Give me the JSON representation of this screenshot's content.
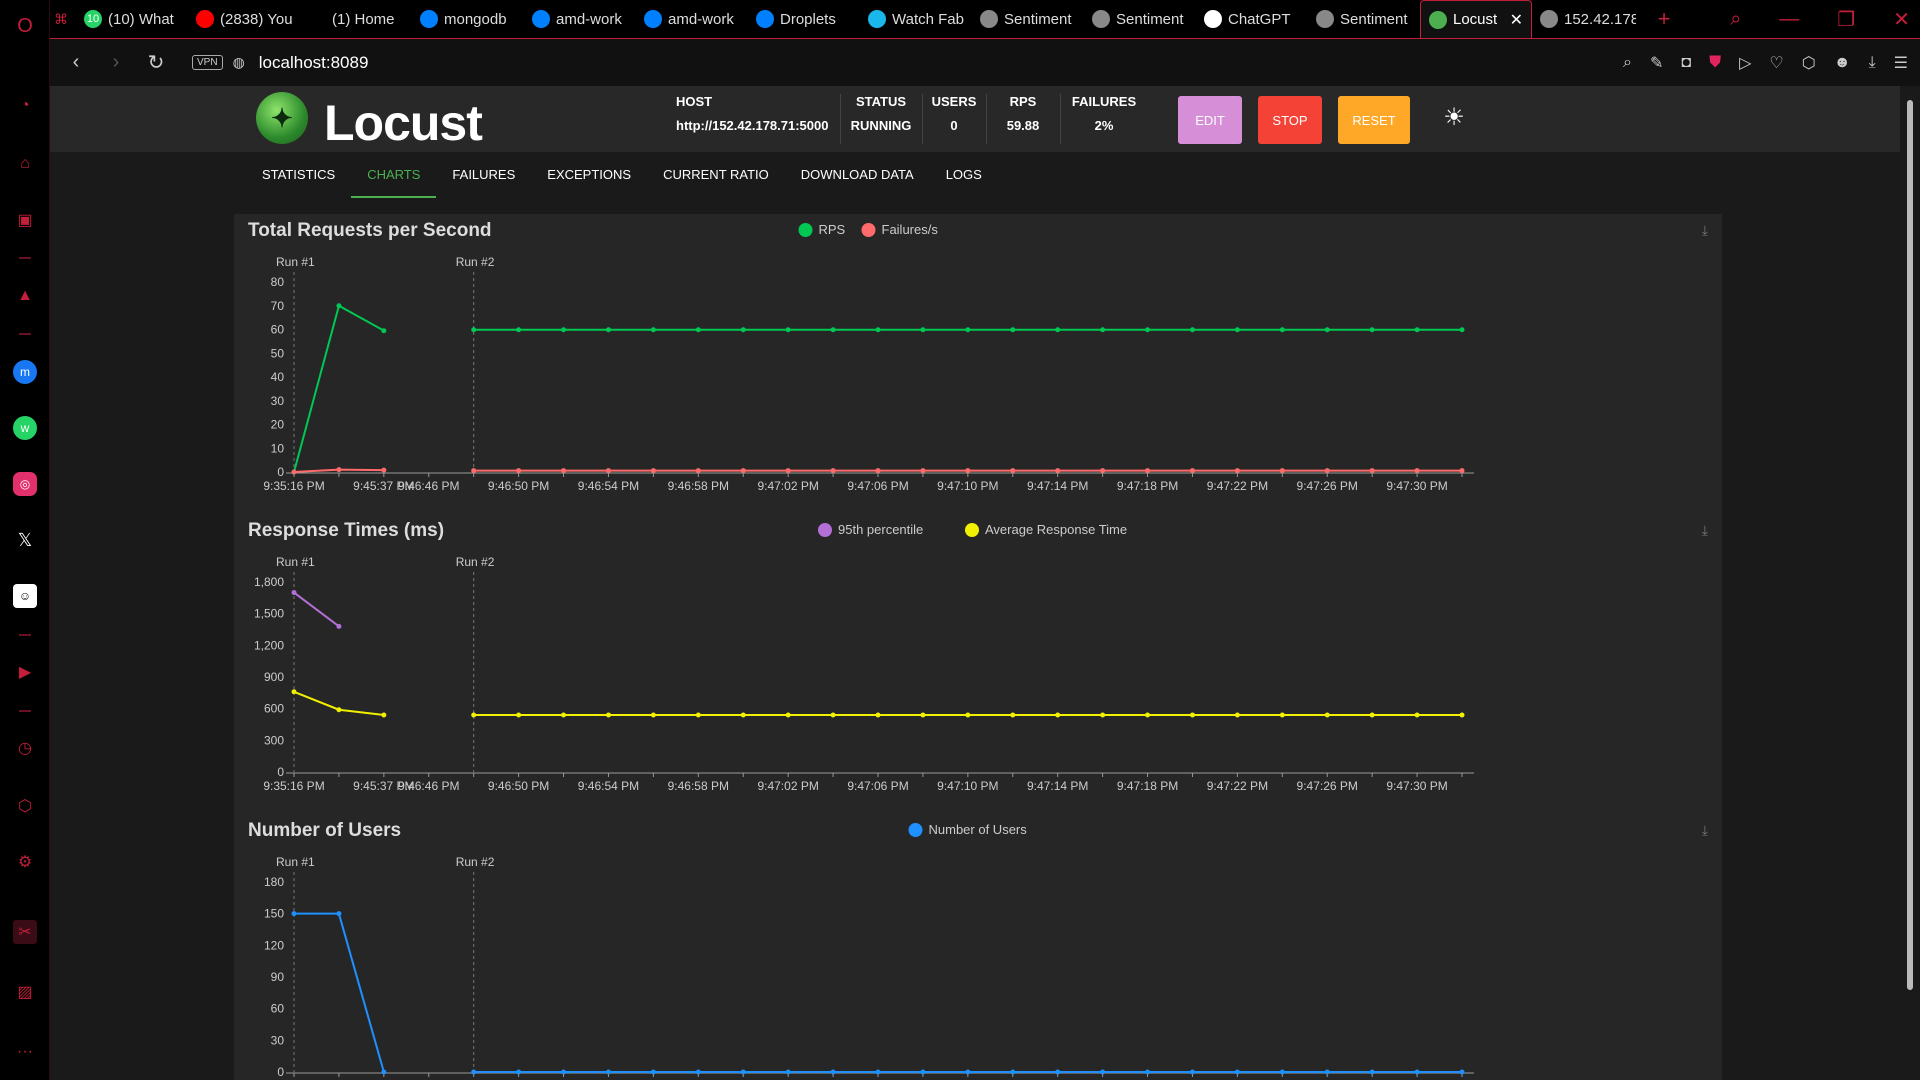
{
  "browser": {
    "tabs": [
      {
        "title": "(10) What",
        "icon": "whatsapp-icon",
        "color": "#25d366",
        "badge": "10"
      },
      {
        "title": "(2838) You",
        "icon": "youtube-icon",
        "color": "#ff0000"
      },
      {
        "title": "(1) Home",
        "icon": "x-icon",
        "color": "#000000"
      },
      {
        "title": "mongodb",
        "icon": "digitalocean-icon",
        "color": "#0080ff"
      },
      {
        "title": "amd-work",
        "icon": "digitalocean-icon",
        "color": "#0080ff"
      },
      {
        "title": "amd-work",
        "icon": "digitalocean-icon",
        "color": "#0080ff"
      },
      {
        "title": "Droplets",
        "icon": "digitalocean-icon",
        "color": "#0080ff"
      },
      {
        "title": "Watch Fab",
        "icon": "play-icon",
        "color": "#1ab7ea"
      },
      {
        "title": "Sentiment",
        "icon": "globe-icon",
        "color": "#888888"
      },
      {
        "title": "Sentiment",
        "icon": "globe-icon",
        "color": "#888888"
      },
      {
        "title": "ChatGPT",
        "icon": "chatgpt-icon",
        "color": "#ffffff"
      },
      {
        "title": "Sentiment",
        "icon": "globe-icon",
        "color": "#888888"
      },
      {
        "title": "Locust",
        "icon": "locust-icon",
        "color": "#4caf50",
        "active": true
      },
      {
        "title": "152.42.178",
        "icon": "globe-icon",
        "color": "#888888"
      }
    ],
    "url": "localhost:8089",
    "vpn_label": "VPN"
  },
  "locust": {
    "logo_text": "Locust",
    "host_label": "HOST",
    "host_value": "http://152.42.178.71:5000",
    "status_label": "STATUS",
    "status_value": "RUNNING",
    "users_label": "USERS",
    "users_value": "0",
    "rps_label": "RPS",
    "rps_value": "59.88",
    "failures_label": "FAILURES",
    "failures_value": "2%",
    "edit_label": "EDIT",
    "stop_label": "STOP",
    "reset_label": "RESET",
    "colors": {
      "edit": "#d68fd6",
      "stop": "#f44336",
      "reset": "#ffa726",
      "accent": "#4caf50"
    },
    "tabs": [
      "STATISTICS",
      "CHARTS",
      "FAILURES",
      "EXCEPTIONS",
      "CURRENT RATIO",
      "DOWNLOAD DATA",
      "LOGS"
    ],
    "active_tab": "CHARTS"
  },
  "chart_data": [
    {
      "type": "line",
      "title": "Total Requests per Second",
      "x": [
        "9:35:16 PM",
        "",
        "9:45:37 PM",
        "9:46:46 PM",
        "",
        "9:46:50 PM",
        "",
        "9:46:54 PM",
        "",
        "9:46:58 PM",
        "",
        "9:47:02 PM",
        "",
        "9:47:06 PM",
        "",
        "9:47:10 PM",
        "",
        "9:47:14 PM",
        "",
        "9:47:18 PM",
        "",
        "9:47:22 PM",
        "",
        "9:47:26 PM",
        "",
        "9:47:30 PM"
      ],
      "ticks": [
        0,
        10,
        20,
        30,
        40,
        50,
        60,
        70,
        80
      ],
      "tick_labels": [
        "0",
        "10",
        "20",
        "30",
        "40",
        "50",
        "60",
        "70",
        "80"
      ],
      "ylim": [
        0,
        80
      ],
      "markers": [
        "Run #1",
        "Run #2"
      ],
      "series": [
        {
          "name": "RPS",
          "color": "#00c853",
          "values": [
            0,
            70,
            59.5,
            null,
            59.9,
            59.9,
            59.9,
            59.9,
            59.9,
            59.9,
            59.9,
            59.9,
            59.9,
            59.9,
            59.9,
            59.9,
            59.9,
            59.9,
            59.9,
            59.9,
            59.9,
            59.9,
            59.9,
            59.9,
            59.9,
            59.9,
            59.9
          ]
        },
        {
          "name": "Failures/s",
          "color": "#ff6b6b",
          "values": [
            0,
            1,
            0.8,
            null,
            0.6,
            0.6,
            0.6,
            0.6,
            0.6,
            0.6,
            0.6,
            0.6,
            0.6,
            0.6,
            0.6,
            0.6,
            0.6,
            0.6,
            0.6,
            0.6,
            0.6,
            0.6,
            0.6,
            0.6,
            0.6,
            0.6,
            0.6
          ]
        }
      ]
    },
    {
      "type": "line",
      "title": "Response Times (ms)",
      "x": [
        "9:35:16 PM",
        "",
        "9:45:37 PM",
        "9:46:46 PM",
        "",
        "9:46:50 PM",
        "",
        "9:46:54 PM",
        "",
        "9:46:58 PM",
        "",
        "9:47:02 PM",
        "",
        "9:47:06 PM",
        "",
        "9:47:10 PM",
        "",
        "9:47:14 PM",
        "",
        "9:47:18 PM",
        "",
        "9:47:22 PM",
        "",
        "9:47:26 PM",
        "",
        "9:47:30 PM"
      ],
      "ticks": [
        0,
        300,
        600,
        900,
        1200,
        1500,
        1800
      ],
      "tick_labels": [
        "0",
        "300",
        "600",
        "900",
        "1,200",
        "1,500",
        "1,800"
      ],
      "ylim": [
        0,
        1800
      ],
      "markers": [
        "Run #1",
        "Run #2"
      ],
      "series": [
        {
          "name": "95th percentile",
          "color": "#b36fd6",
          "values": [
            1700,
            1380,
            null,
            null
          ]
        },
        {
          "name": "Average Response Time",
          "color": "#f0f000",
          "values": [
            760,
            590,
            540,
            null,
            540,
            540,
            540,
            540,
            540,
            540,
            540,
            540,
            540,
            540,
            540,
            540,
            540,
            540,
            540,
            540,
            540,
            540,
            540,
            540,
            540,
            540,
            540
          ]
        }
      ]
    },
    {
      "type": "line",
      "title": "Number of Users",
      "x": [
        "9:35:16 PM",
        "",
        "9:45:37 PM",
        "9:46:46 PM",
        "",
        "9:46:50 PM",
        "",
        "9:46:54 PM",
        "",
        "9:46:58 PM",
        "",
        "9:47:02 PM",
        "",
        "9:47:06 PM",
        "",
        "9:47:10 PM",
        "",
        "9:47:14 PM",
        "",
        "9:47:18 PM",
        "",
        "9:47:22 PM",
        "",
        "9:47:26 PM",
        "",
        "9:47:30 PM"
      ],
      "ticks": [
        0,
        30,
        60,
        90,
        120,
        150,
        180
      ],
      "tick_labels": [
        "0",
        "30",
        "60",
        "90",
        "120",
        "150",
        "180"
      ],
      "ylim": [
        0,
        180
      ],
      "markers": [
        "Run #1",
        "Run #2"
      ],
      "series": [
        {
          "name": "Number of Users",
          "color": "#1e90ff",
          "values": [
            150,
            150,
            0,
            null,
            0,
            0,
            0,
            0,
            0,
            0,
            0,
            0,
            0,
            0,
            0,
            0,
            0,
            0,
            0,
            0,
            0,
            0,
            0,
            0,
            0,
            0,
            0
          ]
        }
      ]
    }
  ]
}
